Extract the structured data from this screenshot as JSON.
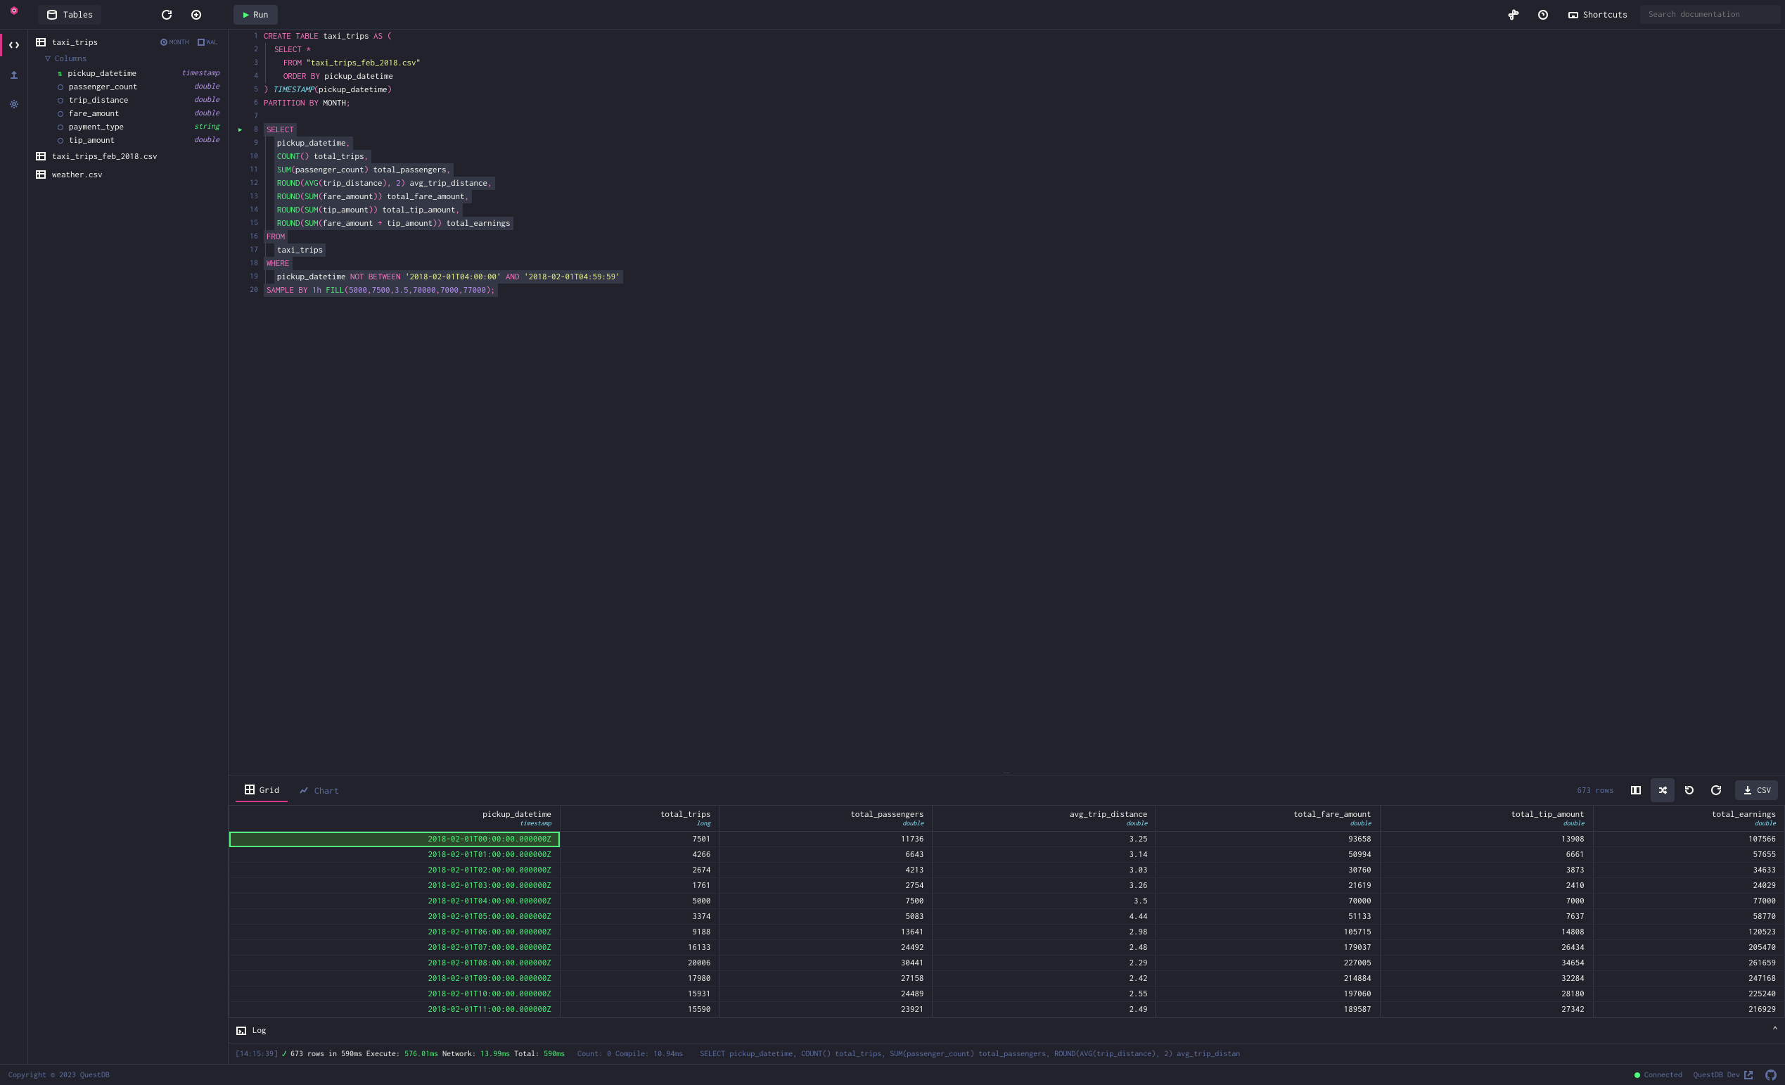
{
  "topbar": {
    "tables_label": "Tables",
    "run_label": "Run",
    "shortcuts_label": "Shortcuts",
    "search_placeholder": "Search documentation"
  },
  "sidebar": {
    "table_name": "taxi_trips",
    "badge_month": "MONTH",
    "badge_wal": "WAL",
    "columns_label": "Columns",
    "columns": [
      {
        "name": "pickup_datetime",
        "type": "timestamp",
        "icon": "sort"
      },
      {
        "name": "passenger_count",
        "type": "double",
        "icon": "circle"
      },
      {
        "name": "trip_distance",
        "type": "double",
        "icon": "circle"
      },
      {
        "name": "fare_amount",
        "type": "double",
        "icon": "circle"
      },
      {
        "name": "payment_type",
        "type": "string",
        "icon": "circle"
      },
      {
        "name": "tip_amount",
        "type": "double",
        "icon": "circle"
      }
    ],
    "csv_files": [
      "taxi_trips_feb_2018.csv",
      "weather.csv"
    ]
  },
  "editor": {
    "lines": [
      {
        "n": 1
      },
      {
        "n": 2
      },
      {
        "n": 3
      },
      {
        "n": 4
      },
      {
        "n": 5
      },
      {
        "n": 6
      },
      {
        "n": 7
      },
      {
        "n": 8,
        "play": true
      },
      {
        "n": 9
      },
      {
        "n": 10
      },
      {
        "n": 11
      },
      {
        "n": 12
      },
      {
        "n": 13
      },
      {
        "n": 14
      },
      {
        "n": 15
      },
      {
        "n": 16
      },
      {
        "n": 17
      },
      {
        "n": 18
      },
      {
        "n": 19
      },
      {
        "n": 20
      }
    ]
  },
  "results": {
    "grid_label": "Grid",
    "chart_label": "Chart",
    "rows_count": "673 rows",
    "csv_label": "CSV",
    "columns": [
      {
        "name": "pickup_datetime",
        "type": "timestamp"
      },
      {
        "name": "total_trips",
        "type": "long"
      },
      {
        "name": "total_passengers",
        "type": "double"
      },
      {
        "name": "avg_trip_distance",
        "type": "double"
      },
      {
        "name": "total_fare_amount",
        "type": "double"
      },
      {
        "name": "total_tip_amount",
        "type": "double"
      },
      {
        "name": "total_earnings",
        "type": "double"
      }
    ],
    "rows": [
      [
        "2018-02-01T00:00:00.000000Z",
        "7501",
        "11736",
        "3.25",
        "93658",
        "13908",
        "107566"
      ],
      [
        "2018-02-01T01:00:00.000000Z",
        "4266",
        "6643",
        "3.14",
        "50994",
        "6661",
        "57655"
      ],
      [
        "2018-02-01T02:00:00.000000Z",
        "2674",
        "4213",
        "3.03",
        "30760",
        "3873",
        "34633"
      ],
      [
        "2018-02-01T03:00:00.000000Z",
        "1761",
        "2754",
        "3.26",
        "21619",
        "2410",
        "24029"
      ],
      [
        "2018-02-01T04:00:00.000000Z",
        "5000",
        "7500",
        "3.5",
        "70000",
        "7000",
        "77000"
      ],
      [
        "2018-02-01T05:00:00.000000Z",
        "3374",
        "5083",
        "4.44",
        "51133",
        "7637",
        "58770"
      ],
      [
        "2018-02-01T06:00:00.000000Z",
        "9188",
        "13641",
        "2.98",
        "105715",
        "14808",
        "120523"
      ],
      [
        "2018-02-01T07:00:00.000000Z",
        "16133",
        "24492",
        "2.48",
        "179037",
        "26434",
        "205470"
      ],
      [
        "2018-02-01T08:00:00.000000Z",
        "20006",
        "30441",
        "2.29",
        "227005",
        "34654",
        "261659"
      ],
      [
        "2018-02-01T09:00:00.000000Z",
        "17980",
        "27158",
        "2.42",
        "214884",
        "32284",
        "247168"
      ],
      [
        "2018-02-01T10:00:00.000000Z",
        "15931",
        "24489",
        "2.55",
        "197060",
        "28180",
        "225240"
      ],
      [
        "2018-02-01T11:00:00.000000Z",
        "15590",
        "23921",
        "2.49",
        "189587",
        "27342",
        "216929"
      ]
    ]
  },
  "log": {
    "label": "Log"
  },
  "status": {
    "time": "[14:15:39]",
    "rows": "673 rows in 590ms",
    "execute_label": "Execute:",
    "execute_val": "576.01ms",
    "network_label": "Network:",
    "network_val": "13.99ms",
    "total_label": "Total:",
    "total_val": "590ms",
    "count_label": "Count: 0",
    "compile_label": "Compile: 10.94ms",
    "query": "SELECT pickup_datetime, COUNT() total_trips, SUM(passenger_count) total_passengers, ROUND(AVG(trip_distance), 2) avg_trip_distan"
  },
  "footer": {
    "copyright": "Copyright © 2023 QuestDB",
    "connected": "Connected",
    "brand": "QuestDB Dev"
  }
}
